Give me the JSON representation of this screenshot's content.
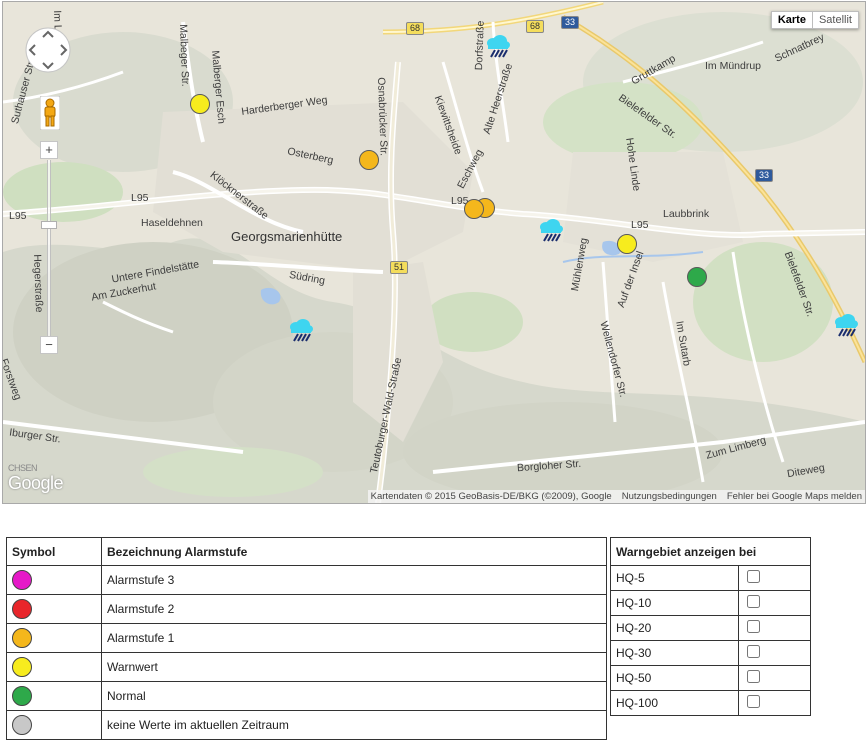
{
  "map": {
    "type_buttons": {
      "map": "Karte",
      "satellite": "Satellit"
    },
    "logo": "Google",
    "logo_fragment": "CHSEN",
    "zoom": {
      "plus": "+",
      "minus": "−"
    },
    "attribution": {
      "data": "Kartendaten © 2015 GeoBasis-DE/BKG (©2009), Google",
      "terms": "Nutzungsbedingungen",
      "report": "Fehler bei Google Maps melden"
    },
    "place_labels": {
      "town": "Georgsmarienhütte",
      "im_loh": "Im Loh",
      "suthauser": "Suthauser Str.",
      "malbeger": "Malbeger Str.",
      "malberger_esch": "Malberger Esch",
      "harderberger": "Harderberger Weg",
      "osnabruecker": "Osnabrücker Str.",
      "dorfstrasse": "Dorfstraße",
      "kiewitt": "Kiewittsheide",
      "alte_heer": "Alte Heerstraße",
      "osterberg": "Osterberg",
      "kloeckner": "Klöcknerstraße",
      "haseldehnen": "Haseldehnen",
      "hegerstrasse": "Hegerstraße",
      "untere": "Untere Findelstätte",
      "zuckerhut": "Am Zuckerhut",
      "suedring": "Südring",
      "eschweg": "Eschweg",
      "muehlenweg": "Mühlenweg",
      "auf_der_insel": "Auf der Insel",
      "wellendorfer": "Wellendorfer Str.",
      "im_sutarb": "Im Sutarb",
      "hohe_linde": "Hohe Linde",
      "laubbrink": "Laubbrink",
      "bielefelder1": "Bielefelder Str.",
      "bielefelder2": "Bielefelder Str.",
      "gruttkamp": "Gruttkamp",
      "im_muendrup": "Im Mündrup",
      "schnatbrey": "Schnatbrey",
      "teutoburger": "Teutoburger-Wald-Straße",
      "iburger": "Iburger Str.",
      "borgloher": "Borgloher Str.",
      "zum_limberg": "Zum Limberg",
      "diteweg": "Diteweg",
      "forstweg": "Forstweg",
      "l95a": "L95",
      "l95b": "L95",
      "l95c": "L95",
      "l95d": "L95",
      "r68a": "68",
      "r68b": "68",
      "r33a": "33",
      "r33b": "33",
      "r51": "51"
    }
  },
  "legend": {
    "headers": {
      "symbol": "Symbol",
      "name": "Bezeichnung Alarmstufe"
    },
    "rows": [
      {
        "label": "Alarmstufe 3",
        "color": "#e619c8"
      },
      {
        "label": "Alarmstufe 2",
        "color": "#e8262b"
      },
      {
        "label": "Alarmstufe 1",
        "color": "#f4b71c"
      },
      {
        "label": "Warnwert",
        "color": "#f7ec1e"
      },
      {
        "label": "Normal",
        "color": "#2ea94a"
      },
      {
        "label": "keine Werte im aktuellen Zeitraum",
        "color": "#c8c8c8"
      }
    ]
  },
  "warngebiet": {
    "header": "Warngebiet anzeigen bei",
    "rows": [
      "HQ-5",
      "HQ-10",
      "HQ-20",
      "HQ-30",
      "HQ-50",
      "HQ-100"
    ]
  }
}
